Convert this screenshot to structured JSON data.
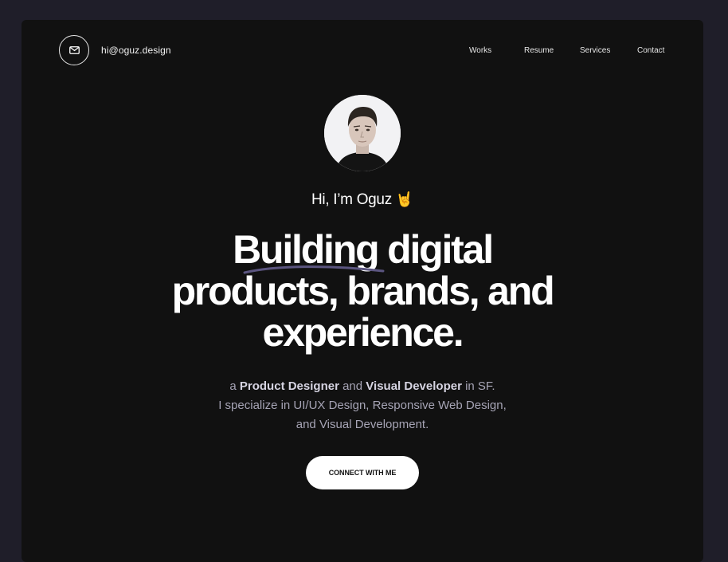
{
  "header": {
    "email": "hi@oguz.design",
    "icon": "mail-icon",
    "nav": [
      "Works",
      "Resume",
      "Services",
      "Contact"
    ]
  },
  "hero": {
    "greeting": "Hi, I’m Oguz",
    "greeting_emoji": "🤘",
    "headline_lines": [
      "Building digital",
      "products, brands, and",
      "experience."
    ],
    "sub_line1": {
      "pre": "a ",
      "role1": "Product Designer",
      "mid": " and ",
      "role2": "Visual Developer",
      "post": " in SF."
    },
    "sub_line2": "I specialize in UI/UX Design, Responsive Web Design,",
    "sub_line3": "and Visual Development.",
    "cta_label": "CONNECT WITH ME"
  },
  "colors": {
    "page_bg": "#1f1e29",
    "card_bg": "#111111",
    "text": "#ffffff",
    "muted_text": "#a6a4b5",
    "accent_underline": "#5b5580",
    "button_bg": "#ffffff"
  }
}
